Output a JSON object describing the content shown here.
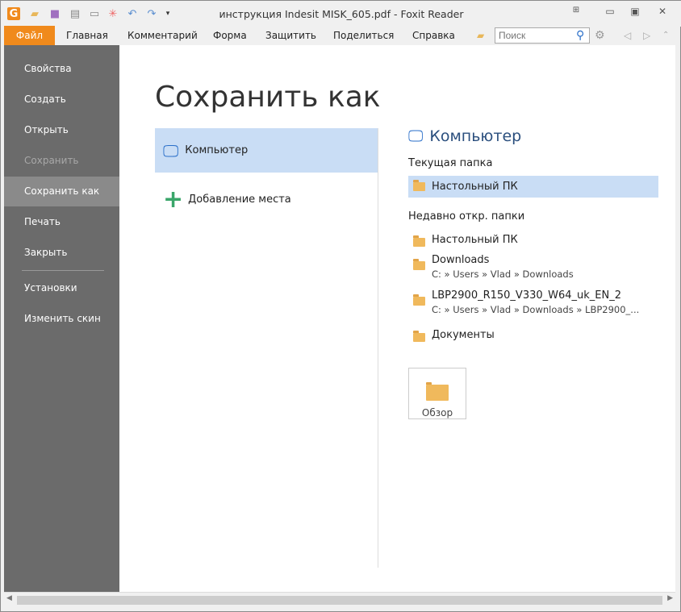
{
  "window": {
    "title": "инструкция Indesit MISK_605.pdf - Foxit Reader"
  },
  "menu": {
    "file": "Файл",
    "items": [
      "Главная",
      "Комментарий",
      "Форма",
      "Защитить",
      "Поделиться",
      "Справка"
    ],
    "search_placeholder": "Поиск"
  },
  "sidebar": {
    "items": [
      {
        "label": "Свойства"
      },
      {
        "label": "Создать"
      },
      {
        "label": "Открыть"
      },
      {
        "label": "Сохранить",
        "disabled": true
      },
      {
        "label": "Сохранить как",
        "selected": true
      },
      {
        "label": "Печать"
      },
      {
        "label": "Закрыть"
      },
      {
        "label": "Установки"
      },
      {
        "label": "Изменить скин"
      }
    ]
  },
  "main": {
    "title": "Сохранить как",
    "locations": [
      "Компьютер",
      "Добавление места"
    ],
    "right": {
      "heading": "Компьютер",
      "current_label": "Текущая папка",
      "current": "Настольный ПК",
      "recent_label": "Недавно откр. папки",
      "recent": [
        {
          "name": "Настольный ПК",
          "path": ""
        },
        {
          "name": "Downloads",
          "path": "C: » Users » Vlad » Downloads"
        },
        {
          "name": "LBP2900_R150_V330_W64_uk_EN_2",
          "path": "C: » Users » Vlad » Downloads » LBP2900_..."
        },
        {
          "name": "Документы",
          "path": ""
        }
      ],
      "browse": "Обзор"
    }
  }
}
